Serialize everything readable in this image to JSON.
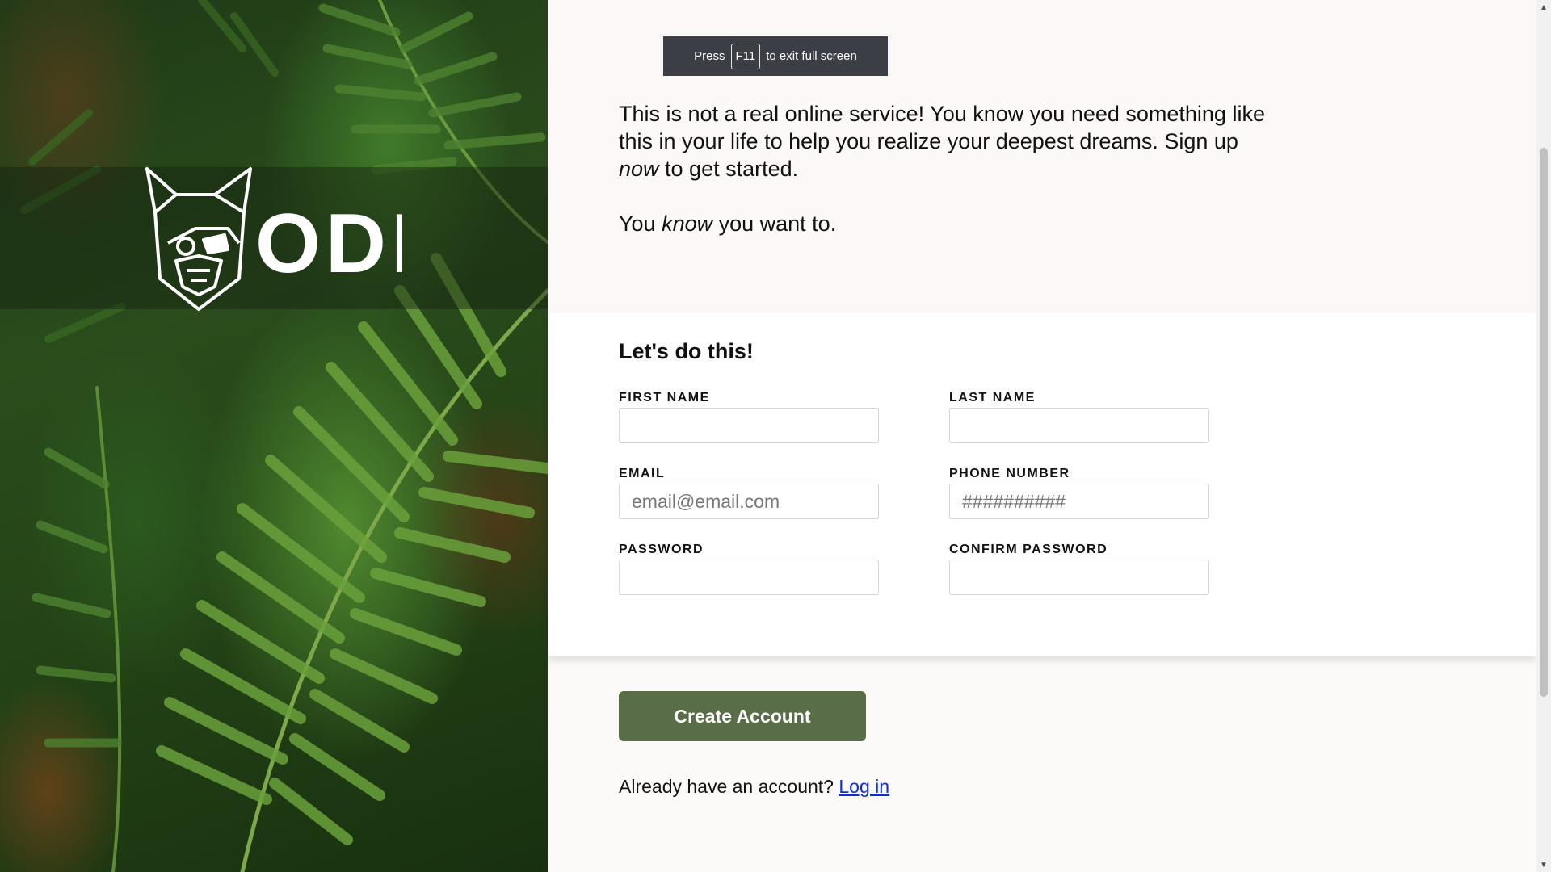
{
  "fullscreen_notice": {
    "before": "Press",
    "key": "F11",
    "after": "to exit full screen"
  },
  "brand": {
    "logo_text": "ODIN",
    "logo_icon": "viking-helmet-icon"
  },
  "intro": {
    "line1": "This is not a real online service! You know you need something like this in your life to help you realize your deepest dreams. Sign up ",
    "line1_em": "now",
    "line1_end": " to get started.",
    "line2_start": "You ",
    "line2_em": "know",
    "line2_end": " you want to."
  },
  "form": {
    "title": "Let's do this!",
    "first_name": {
      "label": "FIRST NAME",
      "value": "",
      "placeholder": ""
    },
    "last_name": {
      "label": "LAST NAME",
      "value": "",
      "placeholder": ""
    },
    "email": {
      "label": "EMAIL",
      "value": "",
      "placeholder": "email@email.com"
    },
    "phone": {
      "label": "PHONE NUMBER",
      "value": "",
      "placeholder": "##########"
    },
    "password": {
      "label": "PASSWORD",
      "value": "",
      "placeholder": ""
    },
    "confirm_password": {
      "label": "CONFIRM PASSWORD",
      "value": "",
      "placeholder": ""
    }
  },
  "actions": {
    "create_label": "Create Account",
    "login_prompt": "Already have an account?",
    "login_link": "Log in"
  },
  "colors": {
    "button": "#596d48",
    "link": "#0b2fd6",
    "intro_bg": "#fcf8f7",
    "form_bg": "#ffffff"
  }
}
